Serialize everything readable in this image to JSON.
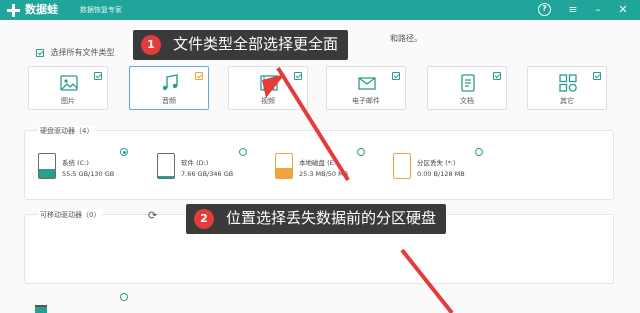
{
  "titlebar": {
    "app_name": "数据蛙",
    "subtitle": "数据恢复专家",
    "help_label": "?",
    "menu_icon": "≡",
    "minimize_icon": "–",
    "close_icon": "✕"
  },
  "hint_text": "和路径。",
  "select_all": {
    "label": "选择所有文件类型"
  },
  "file_types": [
    {
      "label": "图片",
      "icon": "image-icon",
      "checked": true
    },
    {
      "label": "音频",
      "icon": "audio-icon",
      "checked": true
    },
    {
      "label": "视频",
      "icon": "video-icon",
      "checked": true
    },
    {
      "label": "电子邮件",
      "icon": "email-icon",
      "checked": true
    },
    {
      "label": "文档",
      "icon": "document-icon",
      "checked": true
    },
    {
      "label": "其它",
      "icon": "other-icon",
      "checked": true
    }
  ],
  "hard_drives": {
    "section_label": "硬盘驱动器（4）",
    "drives": [
      {
        "name": "系统 (C:)",
        "size": "55.5 GB/130 GB",
        "used_fraction": 0.43,
        "selected": true,
        "color": "#2a9d8f"
      },
      {
        "name": "软件 (D:)",
        "size": "7.66 GB/346 GB",
        "used_fraction": 0.02,
        "selected": false,
        "color": "#2a9d8f"
      },
      {
        "name": "本地磁盘 (E:)",
        "size": "25.3 MB/50 MB",
        "used_fraction": 0.5,
        "selected": false,
        "color": "#f0a43a"
      },
      {
        "name": "分区丢失 (*:)",
        "size": "0.00 B/128 MB",
        "used_fraction": 0.0,
        "selected": false,
        "color": "#f0a43a"
      }
    ]
  },
  "removable": {
    "section_label": "可移动驱动器（0）"
  },
  "callouts": [
    {
      "num": "1",
      "text": "文件类型全部选择更全面"
    },
    {
      "num": "2",
      "text": "位置选择丢失数据前的分区硬盘"
    }
  ],
  "colors": {
    "accent": "#1fa59a",
    "callout_bg": "#3a3a3a",
    "callout_num": "#e43b3b",
    "arrow": "#e43b3b"
  }
}
